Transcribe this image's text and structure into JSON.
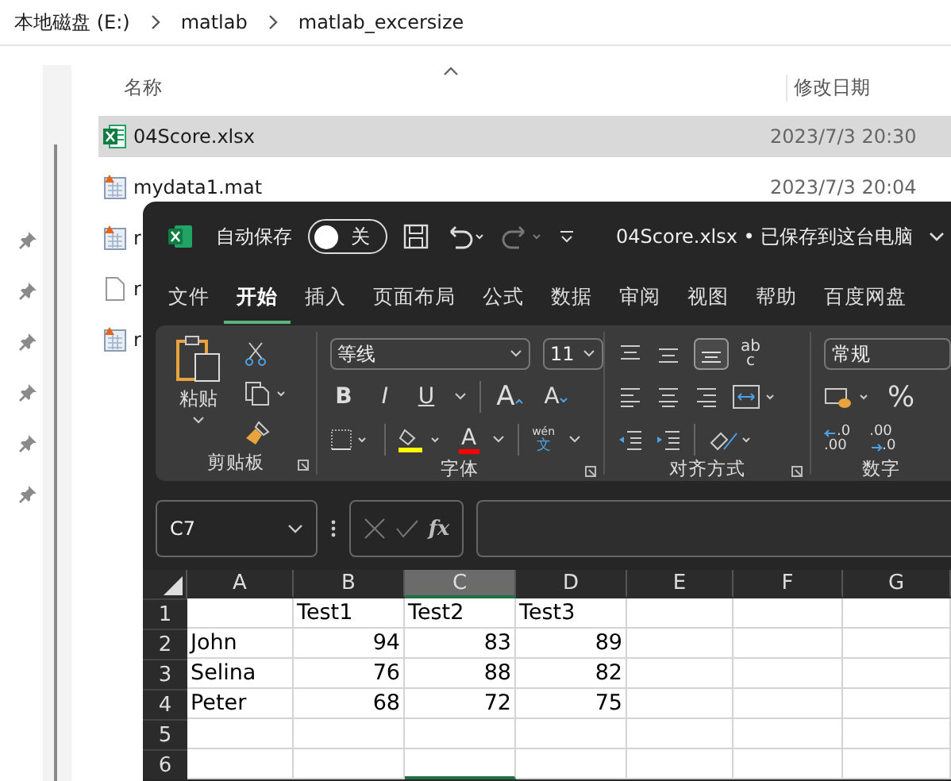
{
  "explorer": {
    "breadcrumb": [
      "本地磁盘 (E:)",
      "matlab",
      "matlab_excersize"
    ],
    "columns": [
      "名称",
      "修改日期"
    ],
    "files": [
      {
        "name": "04Score.xlsx",
        "date": "2023/7/3 20:30",
        "kind": "excel",
        "selected": true
      },
      {
        "name": "mydata1.mat",
        "date": "2023/7/3 20:04",
        "kind": "mat",
        "selected": false
      },
      {
        "name": "r",
        "kind": "mat",
        "selected": false
      },
      {
        "name": "r",
        "kind": "blank",
        "selected": false
      },
      {
        "name": "r",
        "kind": "mat",
        "selected": false
      }
    ]
  },
  "excel": {
    "autosave": {
      "label": "自动保存",
      "on": false,
      "state_text": "关"
    },
    "title": "04Score.xlsx • 已保存到这台电脑",
    "tabs": [
      {
        "label": "文件",
        "selected": false
      },
      {
        "label": "开始",
        "selected": true
      },
      {
        "label": "插入",
        "selected": false
      },
      {
        "label": "页面布局",
        "selected": false
      },
      {
        "label": "公式",
        "selected": false
      },
      {
        "label": "数据",
        "selected": false
      },
      {
        "label": "审阅",
        "selected": false
      },
      {
        "label": "视图",
        "selected": false
      },
      {
        "label": "帮助",
        "selected": false
      },
      {
        "label": "百度网盘",
        "selected": false
      }
    ],
    "ribbon": {
      "clipboard": {
        "paste": "粘贴",
        "label": "剪贴板"
      },
      "font": {
        "name": "等线",
        "size": "11",
        "bold": "B",
        "italic": "I",
        "underline": "U",
        "grow": "A",
        "shrink": "A",
        "color_letter": "A",
        "phonetic": [
          "wén",
          "文"
        ],
        "label": "字体"
      },
      "alignment": {
        "wrap": [
          "ab",
          "c"
        ],
        "label": "对齐方式"
      },
      "number": {
        "format": "常规",
        "percent": "%",
        "decimals": [
          ".0",
          ".00",
          ".00",
          ".0"
        ],
        "label": "数字"
      }
    },
    "name_box": "C7",
    "formula_symbol": "fx",
    "sheet": {
      "columns": [
        {
          "label": "A",
          "selected": false
        },
        {
          "label": "B",
          "selected": false
        },
        {
          "label": "C",
          "selected": true
        },
        {
          "label": "D",
          "selected": false
        },
        {
          "label": "E",
          "selected": false
        },
        {
          "label": "F",
          "selected": false
        },
        {
          "label": "G",
          "selected": false
        }
      ],
      "rows": [
        {
          "header": "1",
          "kind": "heading",
          "cells": {
            "B": "Test1",
            "C": "Test2",
            "D": "Test3"
          }
        },
        {
          "header": "2",
          "kind": "data",
          "cells": {
            "A": "John",
            "B": "94",
            "C": "83",
            "D": "89"
          }
        },
        {
          "header": "3",
          "kind": "data",
          "cells": {
            "A": "Selina",
            "B": "76",
            "C": "88",
            "D": "82"
          }
        },
        {
          "header": "4",
          "kind": "data",
          "cells": {
            "A": "Peter",
            "B": "68",
            "C": "72",
            "D": "75"
          }
        },
        {
          "header": "5",
          "kind": "data",
          "cells": {}
        },
        {
          "header": "6",
          "kind": "data",
          "cells": {}
        }
      ]
    }
  }
}
